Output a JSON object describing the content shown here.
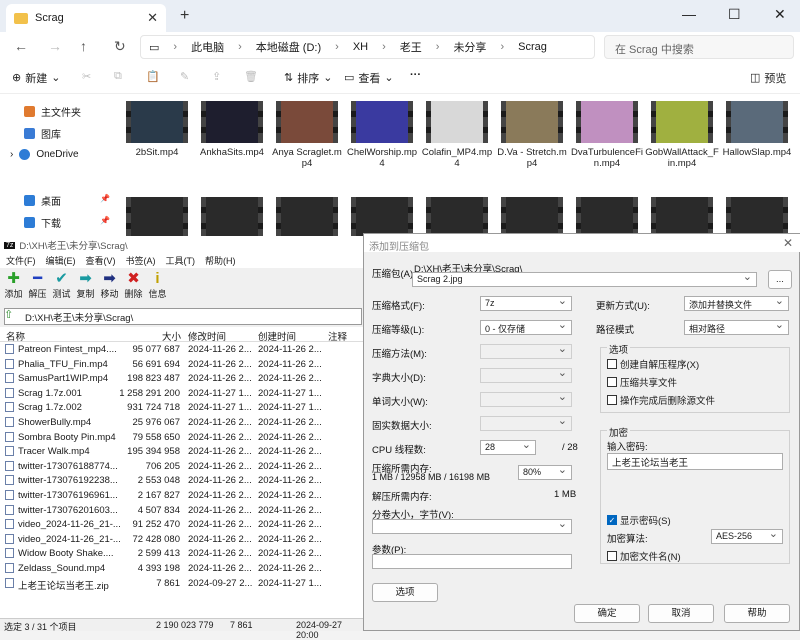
{
  "explorer": {
    "tab_title": "Scrag",
    "breadcrumb": [
      "此电脑",
      "本地磁盘 (D:)",
      "XH",
      "老王",
      "未分享",
      "Scrag"
    ],
    "search_placeholder": "在 Scrag 中搜索",
    "commands": {
      "new": "新建",
      "sort": "排序",
      "view": "查看",
      "more": "···",
      "preview": "预览"
    },
    "sidebar": [
      {
        "label": "主文件夹",
        "color": "#e07a2f"
      },
      {
        "label": "图库",
        "color": "#3a7bd5"
      },
      {
        "label": "OneDrive",
        "color": "#2d7cd6"
      },
      {
        "label": "桌面",
        "color": "#2d7cd6"
      },
      {
        "label": "下载",
        "color": "#2d7cd6"
      }
    ],
    "files": [
      {
        "name": "2bSit.mp4",
        "color": "#2a3a4a"
      },
      {
        "name": "AnkhaSits.mp4",
        "color": "#1e1e2e"
      },
      {
        "name": "Anya Scraglet.mp4",
        "color": "#7a4a3a"
      },
      {
        "name": "ChelWorship.mp4",
        "color": "#3a3aa0"
      },
      {
        "name": "Colafin_MP4.mp4",
        "color": "#d8d8d8"
      },
      {
        "name": "D.Va - Stretch.mp4",
        "color": "#8a7a5a"
      },
      {
        "name": "DvaTurbulenceFin.mp4",
        "color": "#c090c0"
      },
      {
        "name": "GobWallAttack_Fin.mp4",
        "color": "#a0b040"
      },
      {
        "name": "HallowSlap.mp4",
        "color": "#5a6a7a"
      }
    ]
  },
  "zip": {
    "title": "D:\\XH\\老王\\未分享\\Scrag\\",
    "menu": [
      "文件(F)",
      "编辑(E)",
      "查看(V)",
      "书签(A)",
      "工具(T)",
      "帮助(H)"
    ],
    "toolbar": [
      {
        "label": "添加",
        "glyph": "✚",
        "color": "#2aa02a"
      },
      {
        "label": "解压",
        "glyph": "━",
        "color": "#2040c0"
      },
      {
        "label": "测试",
        "glyph": "✔",
        "color": "#1a9aa0"
      },
      {
        "label": "复制",
        "glyph": "➡",
        "color": "#1a9aa0"
      },
      {
        "label": "移动",
        "glyph": "➡",
        "color": "#203080"
      },
      {
        "label": "删除",
        "glyph": "✖",
        "color": "#d02020"
      },
      {
        "label": "信息",
        "glyph": "i",
        "color": "#c0a000"
      }
    ],
    "path": "D:\\XH\\老王\\未分享\\Scrag\\",
    "columns": [
      "名称",
      "大小",
      "修改时间",
      "创建时间",
      "注释"
    ],
    "rows": [
      [
        "Patreon Fintest_mp4....",
        "95 077 687",
        "2024-11-26 2...",
        "2024-11-26 2..."
      ],
      [
        "Phalia_TFU_Fin.mp4",
        "56 691 694",
        "2024-11-26 2...",
        "2024-11-26 2..."
      ],
      [
        "SamusPart1WIP.mp4",
        "198 823 487",
        "2024-11-26 2...",
        "2024-11-26 2..."
      ],
      [
        "Scrag 1.7z.001",
        "1 258 291 200",
        "2024-11-27 1...",
        "2024-11-27 1..."
      ],
      [
        "Scrag 1.7z.002",
        "931 724 718",
        "2024-11-27 1...",
        "2024-11-27 1..."
      ],
      [
        "ShowerBully.mp4",
        "25 976 067",
        "2024-11-26 2...",
        "2024-11-26 2..."
      ],
      [
        "Sombra Booty Pin.mp4",
        "79 558 650",
        "2024-11-26 2...",
        "2024-11-26 2..."
      ],
      [
        "Tracer Walk.mp4",
        "195 394 958",
        "2024-11-26 2...",
        "2024-11-26 2..."
      ],
      [
        "twitter-173076188774...",
        "706 205",
        "2024-11-26 2...",
        "2024-11-26 2..."
      ],
      [
        "twitter-173076192238...",
        "2 553 048",
        "2024-11-26 2...",
        "2024-11-26 2..."
      ],
      [
        "twitter-173076196961...",
        "2 167 827",
        "2024-11-26 2...",
        "2024-11-26 2..."
      ],
      [
        "twitter-173076201603...",
        "4 507 834",
        "2024-11-26 2...",
        "2024-11-26 2..."
      ],
      [
        "video_2024-11-26_21-...",
        "91 252 470",
        "2024-11-26 2...",
        "2024-11-26 2..."
      ],
      [
        "video_2024-11-26_21-...",
        "72 428 080",
        "2024-11-26 2...",
        "2024-11-26 2..."
      ],
      [
        "Widow Booty Shake....",
        "2 599 413",
        "2024-11-26 2...",
        "2024-11-26 2..."
      ],
      [
        "Zeldass_Sound.mp4",
        "4 393 198",
        "2024-11-26 2...",
        "2024-11-26 2..."
      ],
      [
        "上老王论坛当老王.zip",
        "7 861",
        "2024-09-27 2...",
        "2024-11-27 1..."
      ]
    ],
    "status": [
      "选定 3 / 31 个项目",
      "2 190 023 779",
      "7 861",
      "2024-09-27 20:00"
    ]
  },
  "dialog": {
    "title": "添加到压缩包",
    "archive_label": "压缩包(A)",
    "archive_dir": "D:\\XH\\老王\\未分享\\Scrag\\",
    "archive_name": "Scrag 2.jpg",
    "browse": "...",
    "format_label": "压缩格式(F):",
    "format": "7z",
    "level_label": "压缩等级(L):",
    "level": "0 - 仅存储",
    "method_label": "压缩方法(M):",
    "dict_label": "字典大小(D):",
    "word_label": "单词大小(W):",
    "solid_label": "固实数据大小:",
    "cpu_label": "CPU 线程数:",
    "cpu": "28",
    "cpu_total": "/ 28",
    "mem_label": "压缩所需内存:",
    "mem_values": "1 MB / 12958 MB / 16198 MB",
    "mem_pct": "80%",
    "unpack_label": "解压所需内存:",
    "unpack_value": "1 MB",
    "split_label": "分卷大小，字节(V):",
    "params_label": "参数(P):",
    "options_btn": "选项",
    "update_label": "更新方式(U):",
    "update": "添加并替换文件",
    "pathmode_label": "路径模式",
    "pathmode": "相对路径",
    "opts_group": "选项",
    "opt1": "创建自解压程序(X)",
    "opt2": "压缩共享文件",
    "opt3": "操作完成后删除源文件",
    "enc_group": "加密",
    "pwd_label": "输入密码:",
    "pwd": "上老王论坛当老王",
    "show_pwd": "显示密码(S)",
    "enc_method_label": "加密算法:",
    "enc_method": "AES-256",
    "enc_names": "加密文件名(N)",
    "ok": "确定",
    "cancel": "取消",
    "help": "帮助"
  }
}
